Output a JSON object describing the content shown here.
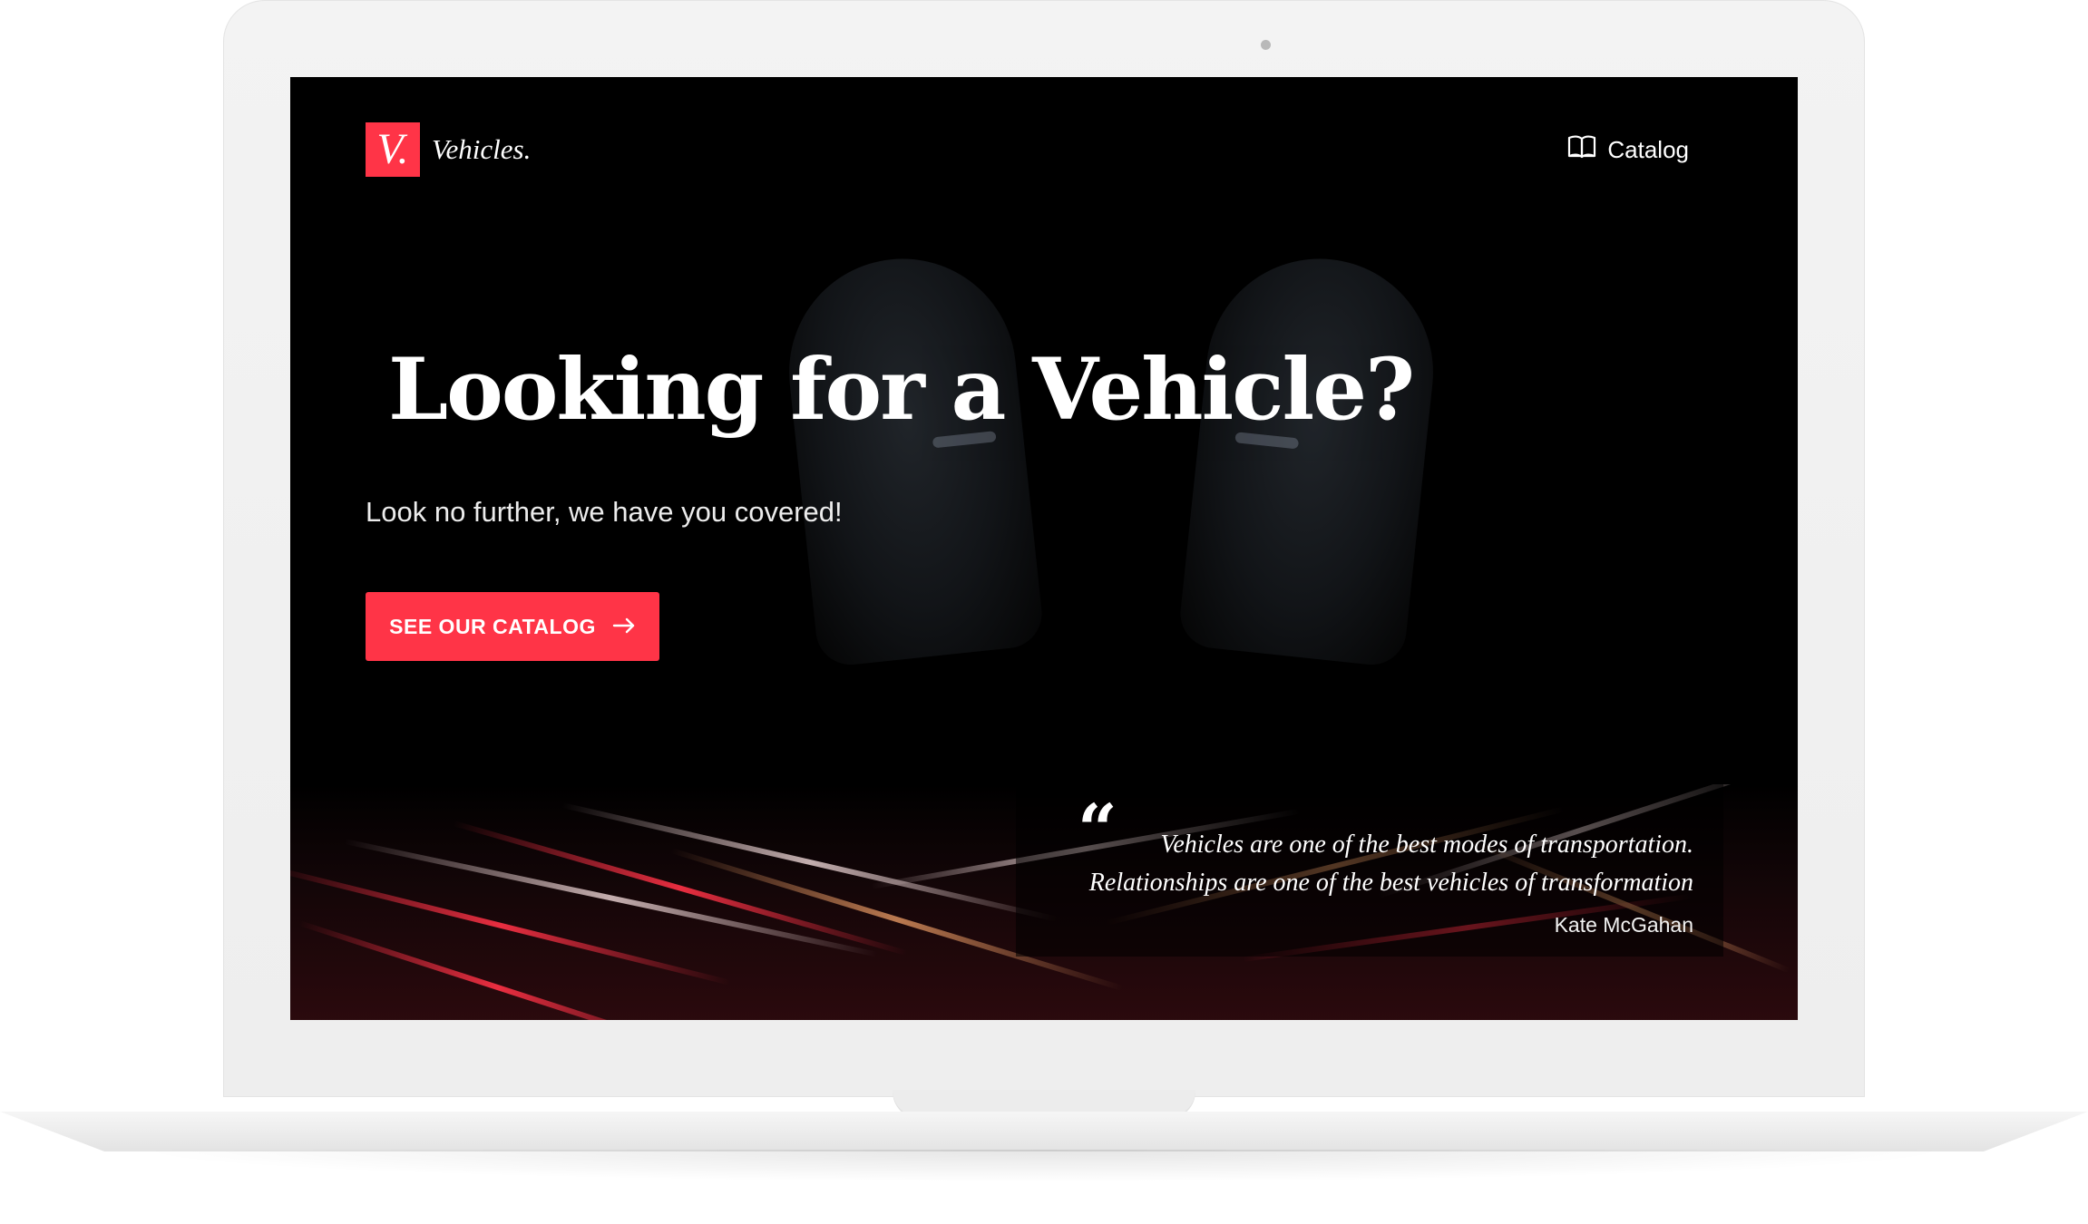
{
  "header": {
    "logo_mark": "V.",
    "logo_text": "Vehicles.",
    "nav_catalog_label": "Catalog",
    "nav_catalog_icon": "book-open-icon"
  },
  "hero": {
    "title": "Looking for a Vehicle?",
    "subtitle": "Look no further, we have you covered!",
    "cta_label": "SEE OUR CATALOG",
    "cta_icon": "arrow-right-icon"
  },
  "quote": {
    "line1": "Vehicles are one of the best modes of transportation.",
    "line2": "Relationships are one of the best vehicles of transformation",
    "author": "Kate McGahan",
    "icon": "quote-icon"
  },
  "colors": {
    "accent": "#ff3447",
    "background": "#000000",
    "text": "#ffffff",
    "device_frame": "#f0f0f0"
  }
}
